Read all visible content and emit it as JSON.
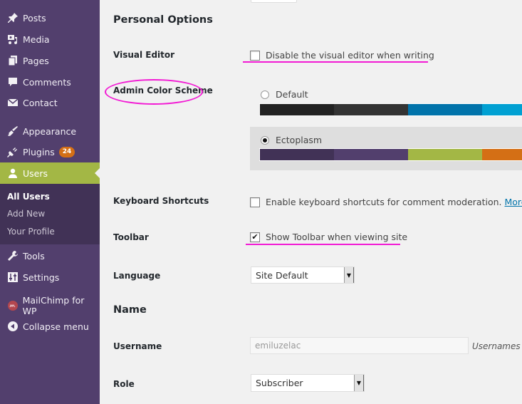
{
  "sidebar": {
    "items": [
      {
        "label": "Posts",
        "icon": "pin-icon"
      },
      {
        "label": "Media",
        "icon": "media-icon"
      },
      {
        "label": "Pages",
        "icon": "pages-icon"
      },
      {
        "label": "Comments",
        "icon": "comment-icon"
      },
      {
        "label": "Contact",
        "icon": "envelope-icon"
      },
      {
        "label": "Appearance",
        "icon": "paintbrush-icon"
      },
      {
        "label": "Plugins",
        "icon": "plug-icon",
        "badge": "24"
      },
      {
        "label": "Users",
        "icon": "user-icon",
        "active": true
      },
      {
        "label": "Tools",
        "icon": "wrench-icon"
      },
      {
        "label": "Settings",
        "icon": "settings-icon"
      },
      {
        "label": "MailChimp for WP",
        "icon": "mailchimp-icon"
      },
      {
        "label": "Collapse menu",
        "icon": "collapse-icon"
      }
    ],
    "submenu": [
      {
        "label": "All Users",
        "current": true
      },
      {
        "label": "Add New"
      },
      {
        "label": "Your Profile"
      }
    ],
    "colors": {
      "background": "#523f6d",
      "active": "#a3b745",
      "submenu": "#413256",
      "badge": "#d46f15"
    }
  },
  "main": {
    "personal_options": {
      "title": "Personal Options",
      "visual_editor": {
        "label": "Visual Editor",
        "checkbox_label": "Disable the visual editor when writing",
        "checked": false
      },
      "admin_color_scheme": {
        "label": "Admin Color Scheme",
        "schemes": [
          {
            "name": "Default",
            "selected": false,
            "colors": [
              "#222222",
              "#333333",
              "#0073aa",
              "#00a0d2"
            ]
          },
          {
            "name": "Ectoplasm",
            "selected": true,
            "colors": [
              "#413256",
              "#523f6d",
              "#a3b745",
              "#d46f15"
            ]
          }
        ]
      },
      "keyboard_shortcuts": {
        "label": "Keyboard Shortcuts",
        "checkbox_label": "Enable keyboard shortcuts for comment moderation.",
        "link": "More informa",
        "checked": false
      },
      "toolbar": {
        "label": "Toolbar",
        "checkbox_label": "Show Toolbar when viewing site",
        "checked": true,
        "check_glyph": "✔"
      },
      "language": {
        "label": "Language",
        "value": "Site Default",
        "arrow": "▼"
      }
    },
    "name": {
      "title": "Name",
      "username": {
        "label": "Username",
        "value": "emiluzelac",
        "description": "Usernames car"
      },
      "role": {
        "label": "Role",
        "value": "Subscriber",
        "arrow": "▼"
      }
    },
    "annotation_color": "#f21ad4"
  }
}
